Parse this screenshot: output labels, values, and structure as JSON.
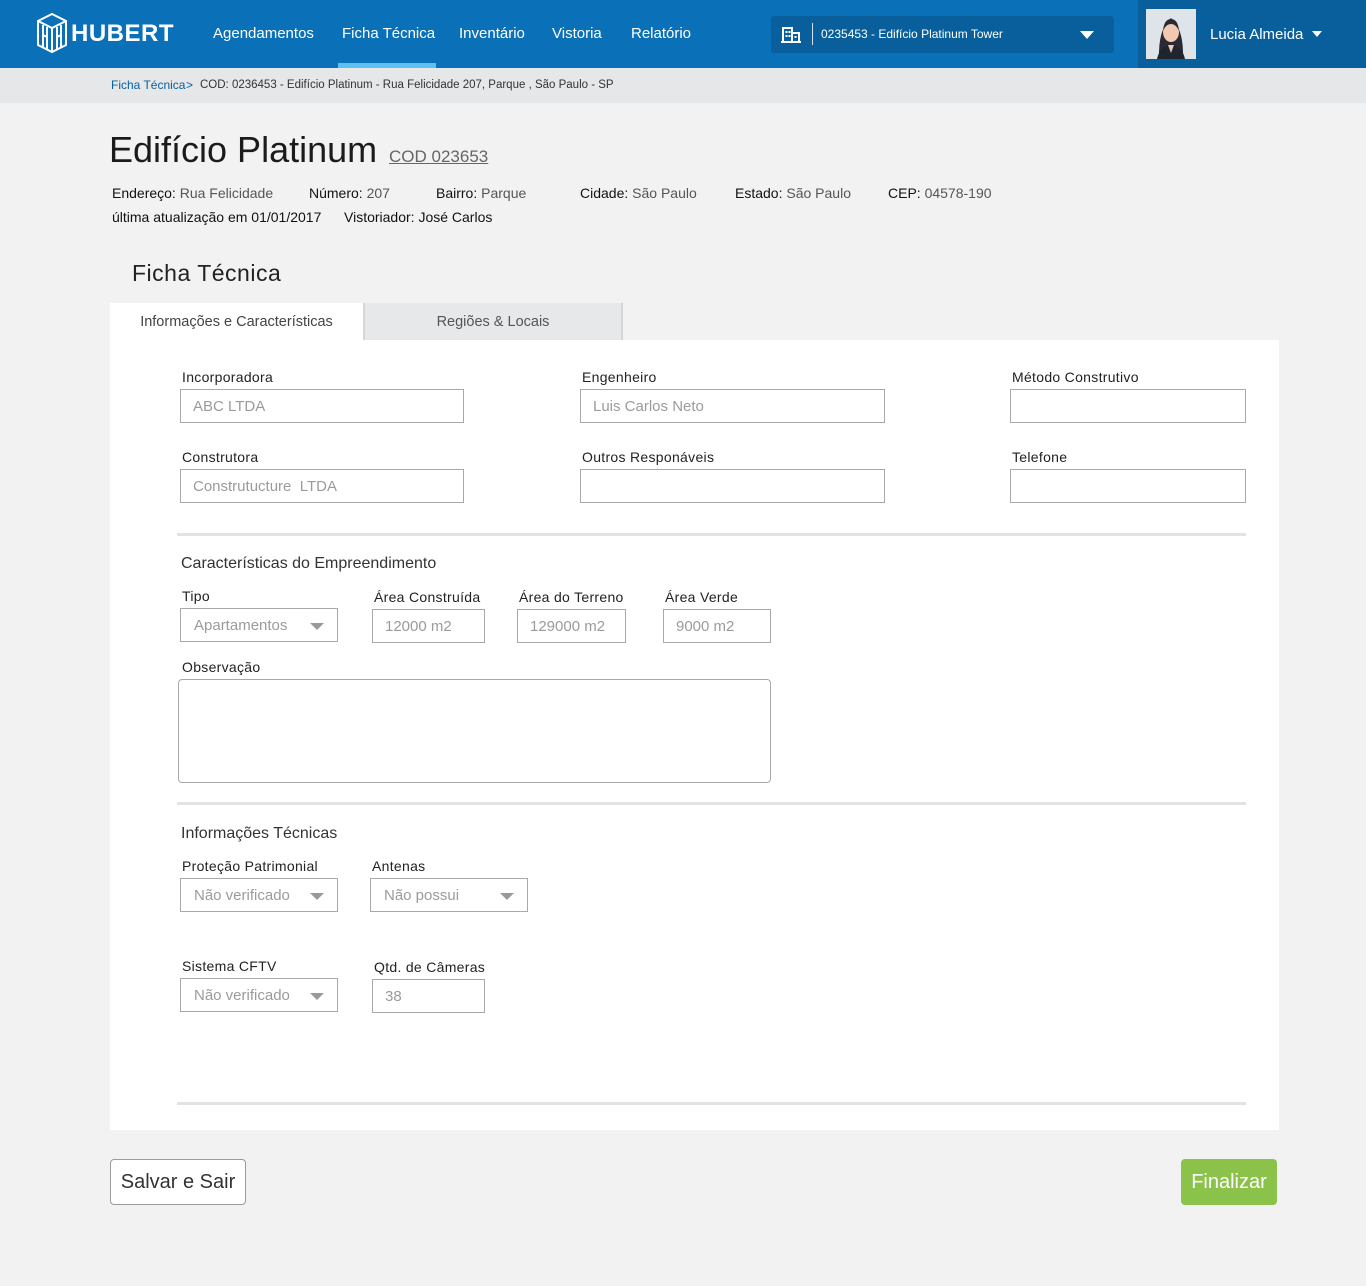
{
  "header": {
    "logo_text": "HUBERT",
    "nav": [
      {
        "label": "Agendamentos"
      },
      {
        "label": "Ficha Técnica"
      },
      {
        "label": "Inventário"
      },
      {
        "label": "Vistoria"
      },
      {
        "label": "Relatório"
      }
    ],
    "active_nav": "Ficha Técnica",
    "building_select": {
      "value": "0235453 - Edifício Platinum Tower",
      "icon": "building-icon"
    },
    "user": {
      "name": "Lucia Almeida",
      "avatar": "user-avatar"
    }
  },
  "breadcrumb": {
    "link": "Ficha Técnica",
    "separator": ">",
    "current": "COD: 0236453 - Edifício Platinum - Rua Felicidade 207,  Parque , São Paulo - SP"
  },
  "building": {
    "title": "Edifício Platinum",
    "code": "COD 023653",
    "endereco_label": "Endereço:",
    "endereco": "Rua Felicidade",
    "numero_label": "Número:",
    "numero": "207",
    "bairro_label": "Bairro:",
    "bairro": "Parque",
    "cidade_label": "Cidade:",
    "cidade": "São Paulo",
    "estado_label": "Estado:",
    "estado": "São Paulo",
    "cep_label": "CEP:",
    "cep": "04578-190",
    "updated": "última atualização em 01/01/2017",
    "vistoriador_label": "Vistoriador:",
    "vistoriador": "José Carlos"
  },
  "section_title": "Ficha Técnica",
  "tabs": [
    {
      "label": "Informações e Características"
    },
    {
      "label": "Regiões & Locais"
    }
  ],
  "active_tab": "Informações e Características",
  "form": {
    "incorporadora": {
      "label": "Incorporadora",
      "placeholder": "ABC LTDA"
    },
    "engenheiro": {
      "label": "Engenheiro",
      "placeholder": "Luis Carlos Neto"
    },
    "metodo": {
      "label": "Método Construtivo",
      "placeholder": ""
    },
    "construtora": {
      "label": "Construtora",
      "placeholder": "Construtucture  LTDA"
    },
    "outros": {
      "label": "Outros Responáveis",
      "placeholder": ""
    },
    "telefone": {
      "label": "Telefone",
      "placeholder": ""
    },
    "caracteristicas_heading": "Características do Empreendimento",
    "tipo": {
      "label": "Tipo",
      "value": "Apartamentos"
    },
    "area_construida": {
      "label": "Área Construída",
      "placeholder": "12000 m2"
    },
    "area_terreno": {
      "label": "Área do Terreno",
      "placeholder": "129000 m2"
    },
    "area_verde": {
      "label": "Área Verde",
      "placeholder": "9000 m2"
    },
    "observacao": {
      "label": "Observação"
    },
    "tecnicas_heading": "Informações Técnicas",
    "protecao": {
      "label": "Proteção Patrimonial",
      "value": "Não verificado"
    },
    "antenas": {
      "label": "Antenas",
      "value": "Não possui"
    },
    "cftv": {
      "label": "Sistema CFTV",
      "value": "Não verificado"
    },
    "cameras": {
      "label": "Qtd. de Câmeras",
      "placeholder": "38"
    }
  },
  "actions": {
    "save": "Salvar e Sair",
    "finish": "Finalizar"
  },
  "colors": {
    "header": "#0a70b8",
    "header_dark": "#095f9c",
    "active_underline": "#5fbff0",
    "finish_button": "#8bc34a"
  }
}
